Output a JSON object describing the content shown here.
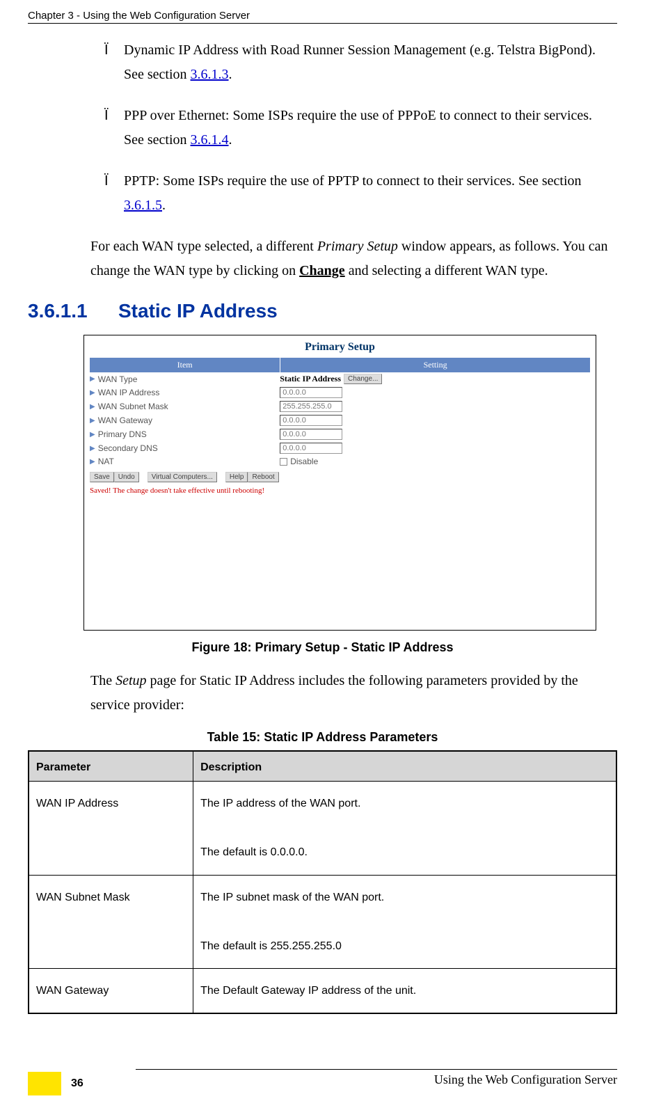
{
  "header": "Chapter 3 - Using the Web Configuration Server",
  "bullets": [
    {
      "marker": "Ï",
      "pre": "Dynamic IP Address with Road Runner Session Management (e.g. Telstra BigPond). See section ",
      "link": "3.6.1.3",
      "post": "."
    },
    {
      "marker": "Ï",
      "pre": "PPP over Ethernet: Some ISPs require the use of PPPoE to connect to their services. See section ",
      "link": "3.6.1.4",
      "post": "."
    },
    {
      "marker": "Ï",
      "pre": "PPTP: Some ISPs require the use of PPTP to connect to their services. See section ",
      "link": "3.6.1.5",
      "post": "."
    }
  ],
  "para": {
    "p1a": "For each WAN type selected, a different ",
    "p1b": "Primary Setup",
    "p1c": " window appears, as follows. You can change the WAN type by clicking on ",
    "p1d": "Change",
    "p1e": " and selecting a different WAN type."
  },
  "section": {
    "num": "3.6.1.1",
    "title": "Static IP Address"
  },
  "figure": {
    "title": "Primary Setup",
    "head_left": "Item",
    "head_right": "Setting",
    "rows": [
      {
        "label": "WAN Type",
        "strong": "Static IP Address",
        "button": "Change..."
      },
      {
        "label": "WAN IP Address",
        "input": "0.0.0.0"
      },
      {
        "label": "WAN Subnet Mask",
        "input": "255.255.255.0"
      },
      {
        "label": "WAN Gateway",
        "input": "0.0.0.0"
      },
      {
        "label": "Primary DNS",
        "input": "0.0.0.0"
      },
      {
        "label": "Secondary DNS",
        "input": "0.0.0.0"
      },
      {
        "label": "NAT",
        "checkbox": true,
        "cblabel": "Disable"
      }
    ],
    "buttons": [
      "Save",
      "Undo",
      "Virtual Computers...",
      "Help",
      "Reboot"
    ],
    "saved": "Saved! The change doesn't take effective until rebooting!",
    "caption": "Figure 18: Primary Setup - Static IP Address"
  },
  "para2a": "The ",
  "para2b": "Setup",
  "para2c": " page for Static IP Address includes the following parameters provided by the service provider:",
  "table": {
    "title": "Table 15: Static IP Address Parameters",
    "h1": "Parameter",
    "h2": "Description",
    "rows": [
      {
        "p": "WAN IP Address",
        "d1": "The IP address of the WAN port.",
        "d2": "The default is 0.0.0.0."
      },
      {
        "p": "WAN Subnet Mask",
        "d1": "The IP subnet mask of the WAN port.",
        "d2": "The default is 255.255.255.0"
      },
      {
        "p": "WAN Gateway",
        "d1": "The Default Gateway IP address of the unit.",
        "d2": ""
      }
    ]
  },
  "footer": "Using the Web Configuration Server",
  "page": "36"
}
